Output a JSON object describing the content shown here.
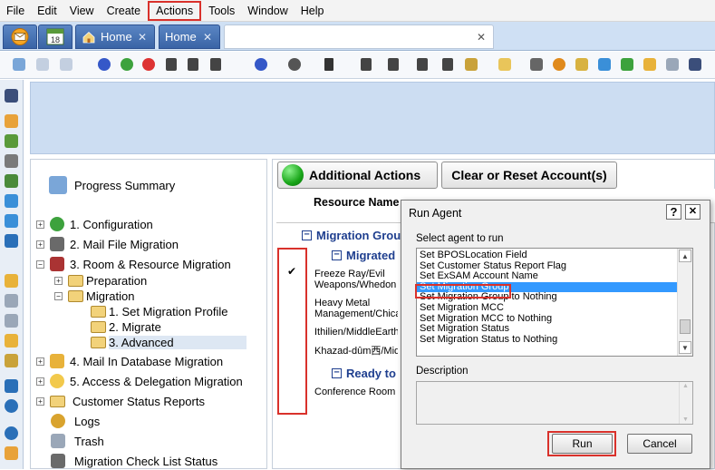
{
  "menu": {
    "items": [
      {
        "label": "File"
      },
      {
        "label": "Edit"
      },
      {
        "label": "View"
      },
      {
        "label": "Create"
      },
      {
        "label": "Actions",
        "highlighted": true
      },
      {
        "label": "Tools"
      },
      {
        "label": "Window"
      },
      {
        "label": "Help"
      }
    ]
  },
  "tabs": {
    "home1": "Home",
    "home2": "Home",
    "close": "✕"
  },
  "nav": {
    "progress_summary": "Progress Summary",
    "configuration": "1. Configuration",
    "mail_file_migration": "2. Mail File Migration",
    "room_resource_migration": "3. Room & Resource Migration",
    "preparation": "Preparation",
    "migration": "Migration",
    "set_migration_profile": "1. Set Migration Profile",
    "migrate": "2. Migrate",
    "advanced": "3. Advanced",
    "mail_in_db_migration": "4. Mail In Database Migration",
    "access_delegation_migration": "5. Access & Delegation Migration",
    "customer_status_reports": "Customer Status Reports",
    "logs": "Logs",
    "trash": "Trash",
    "migration_checklist_status": "Migration Check List Status"
  },
  "actions": {
    "additional_actions": "Additional Actions",
    "clear_reset": "Clear or Reset Account(s)"
  },
  "view": {
    "column_resource_name": "Resource Name",
    "group_migration": "Migration Grou",
    "group_migrated": "Migrated",
    "group_ready": "Ready to",
    "checkmark": "✔",
    "rows": [
      {
        "line1": "Freeze Ray/Evil",
        "line2": "Weapons/Whedon"
      },
      {
        "line1": "Heavy Metal",
        "line2": "Management/Chica"
      },
      {
        "line1": "Ithilien/MiddleEarth",
        "line2": ""
      },
      {
        "line1": "Khazad-dûm西/Mid",
        "line2": ""
      }
    ],
    "conference_row": "Conference Room T"
  },
  "dialog": {
    "title": "Run Agent",
    "help_btn": "?",
    "close_btn": "✕",
    "select_label": "Select agent to run",
    "agents": [
      "Set BPOSLocation Field",
      "Set Customer Status Report Flag",
      "Set ExSAM Account Name",
      "Set Migration Group",
      "Set Migration Group to Nothing",
      "Set Migration MCC",
      "Set Migration MCC to Nothing",
      "Set Migration Status",
      "Set Migration Status to Nothing"
    ],
    "selected_agent": "Set Migration Group",
    "description_label": "Description",
    "description_text": "",
    "run_label": "Run",
    "cancel_label": "Cancel"
  },
  "colors": {
    "highlight_red": "#d9312b",
    "selection_blue": "#3399ff",
    "group_text_blue": "#1f3f8f",
    "banner_blue": "#ccddf2"
  }
}
